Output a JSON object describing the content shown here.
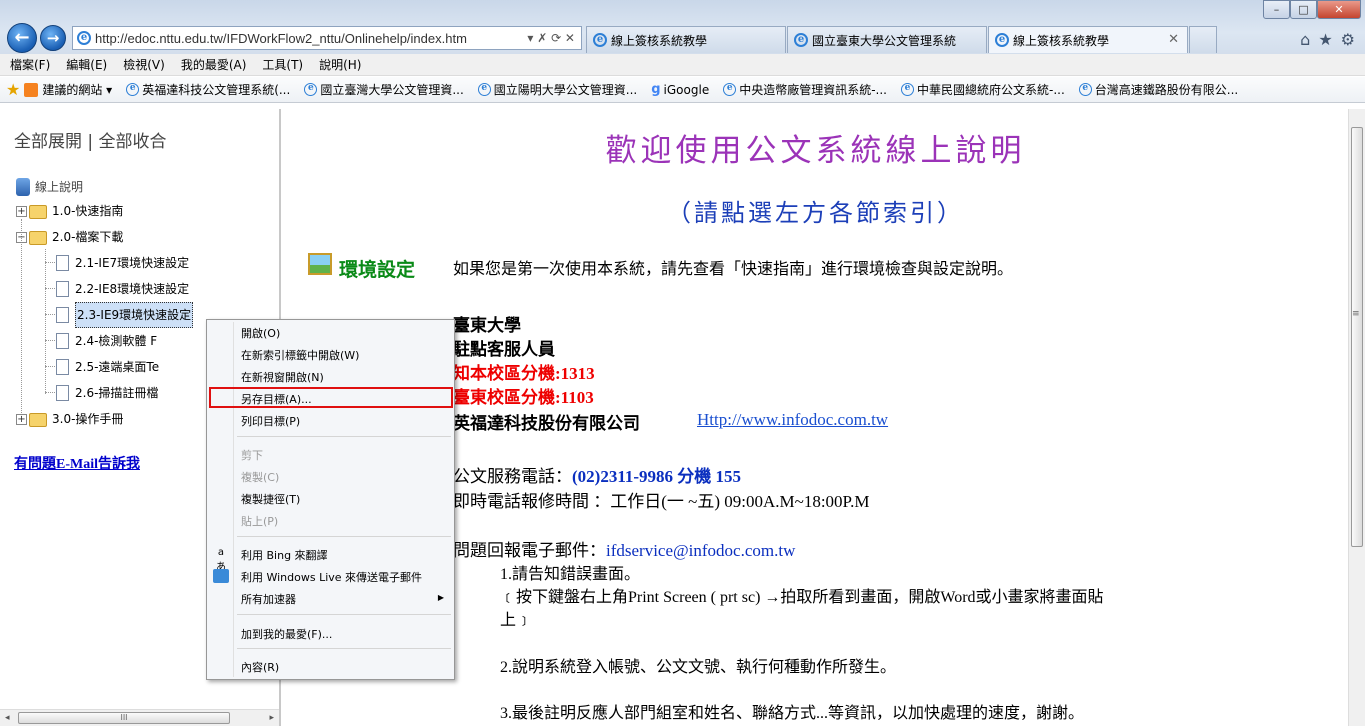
{
  "browser": {
    "address": "http://edoc.nttu.edu.tw/IFDWorkFlow2_nttu/Onlinehelp/index.htm",
    "address_controls": "▾ ✗ ⟳ ✕",
    "tabs": [
      {
        "label": "線上簽核系統教學"
      },
      {
        "label": "國立臺東大學公文管理系統"
      },
      {
        "label": "線上簽核系統教學"
      }
    ],
    "tab_close": "✕",
    "window_controls": {
      "minimize": "–",
      "maximize": "□",
      "close": "✕"
    },
    "toolbar_icons": {
      "home": "⌂",
      "favorites": "★",
      "tools": "⚙"
    }
  },
  "menubar": [
    "檔案(F)",
    "編輯(E)",
    "檢視(V)",
    "我的最愛(A)",
    "工具(T)",
    "說明(H)"
  ],
  "favorites": [
    {
      "label": "建議的網站 ▾",
      "icon": "suggested-sites-icon"
    },
    {
      "label": "英福達科技公文管理系統(...",
      "icon": "ie-page-icon"
    },
    {
      "label": "國立臺灣大學公文管理資...",
      "icon": "ie-page-icon"
    },
    {
      "label": "國立陽明大學公文管理資...",
      "icon": "ie-page-icon"
    },
    {
      "label": "iGoogle",
      "icon": "google-icon"
    },
    {
      "label": "中央造幣廠管理資訊系統-...",
      "icon": "ie-page-icon"
    },
    {
      "label": "中華民國總統府公文系統-...",
      "icon": "ie-page-icon"
    },
    {
      "label": "台灣高速鐵路股份有限公...",
      "icon": "ie-page-icon"
    }
  ],
  "left": {
    "expand_all": "全部展開",
    "divider": "|",
    "collapse_all": "全部收合",
    "tree_root": "線上說明",
    "expander_plus": "+",
    "expander_minus": "−",
    "tree": [
      {
        "label": "1.0-快速指南"
      },
      {
        "label": "2.0-檔案下載"
      },
      {
        "label": "2.1-IE7環境快速設定"
      },
      {
        "label": "2.2-IE8環境快速設定"
      },
      {
        "label": "2.3-IE9環境快速設定"
      },
      {
        "label": "2.4-檢測軟體 F"
      },
      {
        "label": "2.5-遠端桌面Te"
      },
      {
        "label": "2.6-掃描註冊檔"
      },
      {
        "label": "3.0-操作手冊"
      }
    ],
    "help_mail": "有問題E-Mail告訴我",
    "scroll_grip": "III",
    "scroll_left": "◂",
    "scroll_right": "▸"
  },
  "main": {
    "title": "歡迎使用公文系統線上說明",
    "subtitle": "（請點選左方各節索引）",
    "env_label": "環境設定",
    "env_text": "如果您是第一次使用本系統，請先查看「快速指南」進行環境檢查與設定說明。",
    "line_university": "臺東大學",
    "line_staff": "駐點客服人員",
    "line_ext1": "知本校區分機:1313",
    "line_ext2": "臺東校區分機:1103",
    "company": "英福達科技股份有限公司",
    "company_url": "Http://www.infodoc.com.tw",
    "phone_label": "公文服務電話：",
    "phone_value": "(02)2311-9986 分機 155",
    "hours": "即時電話報修時間 ：工作日(一 ~五) 09:00A.M~18:00P.M",
    "email_label": "問題回報電子郵件：",
    "email_value": "ifdservice@infodoc.com.tw",
    "step1": "1.請告知錯誤畫面。",
    "step1_detail_a": "﹝按下鍵盤右上角Print Screen ( prt sc) →拍取所看到畫面，開啟Word或小畫家將畫面貼",
    "step1_detail_b": "上﹞",
    "step2": "2.說明系統登入帳號、公文文號、執行何種動作所發生。",
    "step3": "3.最後註明反應人部門組室和姓名、聯絡方式...等資訊，以加快處理的速度，謝謝。"
  },
  "context_menu": {
    "items": [
      {
        "label": "開啟(O)"
      },
      {
        "label": "在新索引標籤中開啟(W)"
      },
      {
        "label": "在新視窗開啟(N)"
      },
      {
        "label": "另存目標(A)..."
      },
      {
        "label": "列印目標(P)"
      },
      {
        "label": "剪下"
      },
      {
        "label": "複製(C)"
      },
      {
        "label": "複製捷徑(T)"
      },
      {
        "label": "貼上(P)"
      },
      {
        "label": "利用 Bing 來翻譯"
      },
      {
        "label": "利用 Windows Live 來傳送電子郵件"
      },
      {
        "label": "所有加速器"
      },
      {
        "label": "加到我的最愛(F)..."
      },
      {
        "label": "內容(R)"
      }
    ],
    "submenu_arrow": "▶",
    "highlight_color": "#e01010"
  },
  "vscroll": {
    "grip": "≡"
  }
}
